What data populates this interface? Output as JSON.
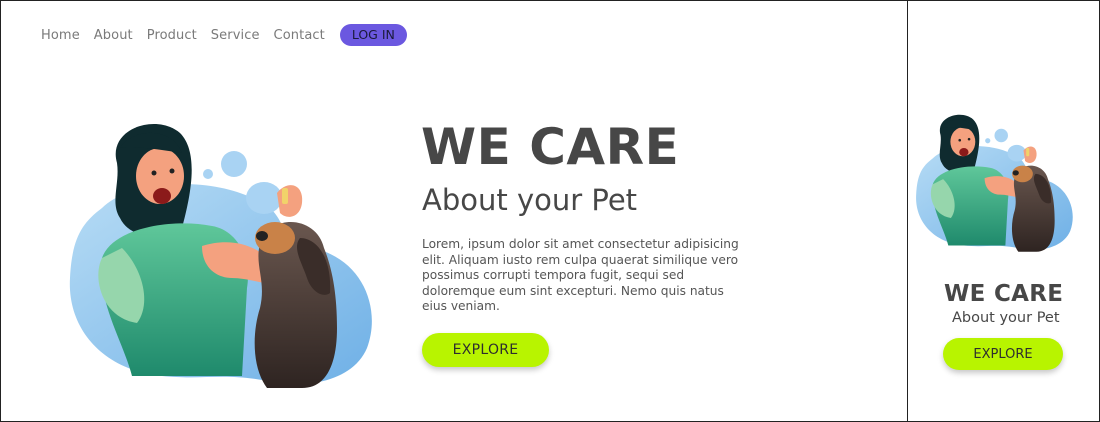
{
  "nav": {
    "items": [
      {
        "label": "Home"
      },
      {
        "label": "About"
      },
      {
        "label": "Product"
      },
      {
        "label": "Service"
      },
      {
        "label": "Contact"
      }
    ],
    "login_label": "LOG IN"
  },
  "hero": {
    "title": "WE CARE",
    "subtitle": "About your Pet",
    "body": "Lorem, ipsum dolor sit amet consectetur adipisicing elit. Aliquam iusto rem culpa quaerat similique vero possimus corrupti tempora fugit, sequi sed doloremque eum sint excepturi. Nemo quis natus eius veniam.",
    "button_label": "EXPLORE"
  },
  "mobile": {
    "title": "WE CARE",
    "subtitle": "About your Pet",
    "button_label": "EXPLORE"
  },
  "colors": {
    "login_bg": "#6b58e0",
    "explore_bg": "#b8f400",
    "blob_blue": "#8ec3ec",
    "shirt_green": "#2f9e7a",
    "dog_brown": "#4a3b36"
  }
}
